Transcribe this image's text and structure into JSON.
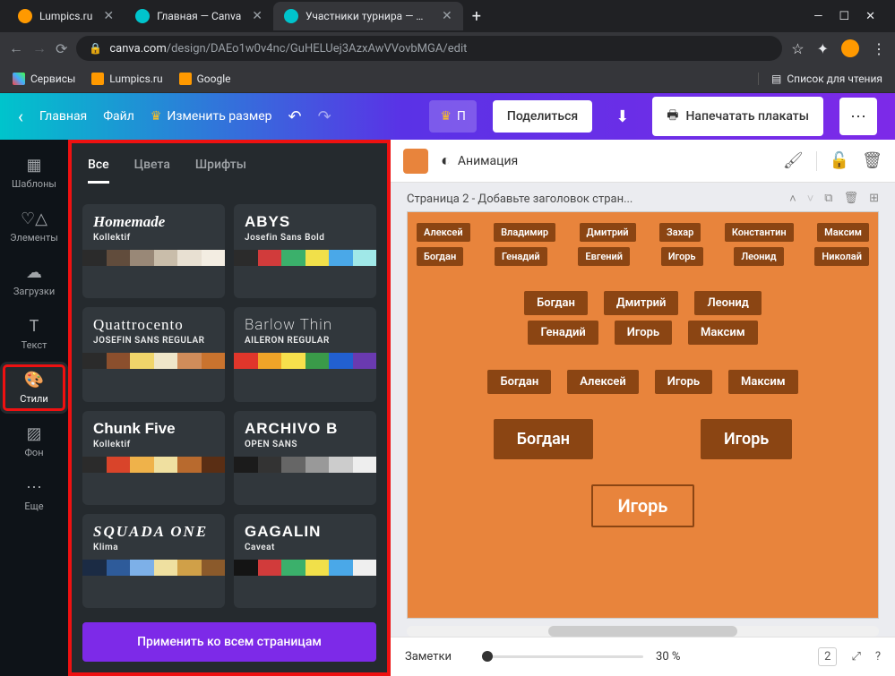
{
  "browser": {
    "tabs": [
      {
        "title": "Lumpics.ru",
        "favicon": "#f90"
      },
      {
        "title": "Главная — Canva",
        "favicon": "#00c4cc"
      },
      {
        "title": "Участники турнира — Плакат",
        "favicon": "#00c4cc",
        "active": true
      }
    ],
    "url_host": "canva.com",
    "url_path": "/design/DAEo1w0v4nc/GuHELUej3AzxAwVVovbMGA/edit",
    "bookmarks": {
      "services": "Сервисы",
      "lumpics": "Lumpics.ru",
      "google": "Google",
      "reading": "Список для чтения"
    }
  },
  "canva_bar": {
    "home": "Главная",
    "file": "Файл",
    "resize": "Изменить размер",
    "share": "Поделиться",
    "print": "Напечатать плакаты"
  },
  "rail": {
    "templates": "Шаблоны",
    "elements": "Элементы",
    "uploads": "Загрузки",
    "text": "Текст",
    "styles": "Стили",
    "background": "Фон",
    "more": "Еще"
  },
  "panel": {
    "tab_all": "Все",
    "tab_colors": "Цвета",
    "tab_fonts": "Шрифты",
    "apply": "Применить ко всем страницам",
    "cards": [
      {
        "title": "Homemade",
        "sub": "Kollektif",
        "font": "font-script",
        "palette": [
          "#2b2b2b",
          "#614c3c",
          "#998877",
          "#c9bdaa",
          "#e8e0d2",
          "#f3ede2"
        ]
      },
      {
        "title": "ABYS",
        "sub": "Josefin Sans Bold",
        "font": "font-brush",
        "palette": [
          "#2b2b2b",
          "#d13b3b",
          "#3bb06b",
          "#f1e04a",
          "#4aa8e8",
          "#a0e8e8"
        ]
      },
      {
        "title": "Quattrocento",
        "sub": "JOSEFIN SANS REGULAR",
        "font": "font-serif",
        "palette": [
          "#2b2b2b",
          "#8b4f2d",
          "#f0d56a",
          "#efe6c9",
          "#d08c5a",
          "#c9732e"
        ]
      },
      {
        "title": "Barlow Thin",
        "sub": "AILERON REGULAR",
        "font": "font-thin",
        "palette": [
          "#e0362b",
          "#f0a428",
          "#f7e04c",
          "#3a9a49",
          "#2260d1",
          "#6a3ab0"
        ]
      },
      {
        "title": "Chunk Five",
        "sub": "Kollektif",
        "font": "font-slab",
        "palette": [
          "#2b2b2b",
          "#d9442a",
          "#efb24a",
          "#f0e0a0",
          "#b86a2e",
          "#5a2e14"
        ]
      },
      {
        "title": "ARCHIVO B",
        "sub": "OPEN SANS",
        "font": "font-black",
        "palette": [
          "#1b1b1b",
          "#333333",
          "#666666",
          "#999999",
          "#cccccc",
          "#eeeeee"
        ]
      },
      {
        "title": "SQUADA ONE",
        "sub": "Klima",
        "font": "font-squada",
        "palette": [
          "#1b2b44",
          "#2e5b9a",
          "#7db0e8",
          "#efe0a0",
          "#d0a048",
          "#8b5a2b"
        ]
      },
      {
        "title": "GAGALIN",
        "sub": "Caveat",
        "font": "font-black",
        "palette": [
          "#141414",
          "#d13b3b",
          "#3bb06b",
          "#f1e04a",
          "#4aa8e8",
          "#efefef"
        ]
      }
    ]
  },
  "canvas": {
    "animation": "Анимация",
    "page_label": "Страница 2 - Добавьте заголовок стран...",
    "rows": {
      "r1": [
        "Алексей",
        "Владимир",
        "Дмитрий",
        "Захар",
        "Константин",
        "Максим"
      ],
      "r2": [
        "Богдан",
        "Генадий",
        "Евгений",
        "Игорь",
        "Леонид",
        "Николай"
      ],
      "r3": [
        "Богдан",
        "Дмитрий",
        "Леонид"
      ],
      "r4": [
        "Генадий",
        "Игорь",
        "Максим"
      ],
      "r5": [
        "Богдан",
        "Алексей",
        "Игорь",
        "Максим"
      ],
      "r6": [
        "Богдан",
        "Игорь"
      ],
      "final": "Игорь"
    }
  },
  "footer": {
    "notes": "Заметки",
    "zoom": "30 %",
    "pages": "2"
  }
}
